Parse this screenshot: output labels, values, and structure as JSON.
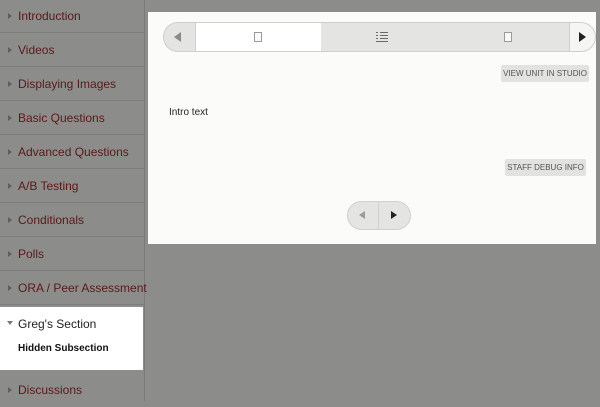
{
  "sidebar": {
    "items": [
      {
        "label": "Introduction"
      },
      {
        "label": "Videos"
      },
      {
        "label": "Displaying Images"
      },
      {
        "label": "Basic Questions"
      },
      {
        "label": "Advanced Questions"
      },
      {
        "label": "A/B Testing"
      },
      {
        "label": "Conditionals"
      },
      {
        "label": "Polls"
      },
      {
        "label": "ORA / Peer Assessment"
      }
    ],
    "active_section": {
      "label": "Greg's Section",
      "subsection": "Hidden Subsection"
    },
    "footer_item": {
      "label": "Discussions"
    }
  },
  "main": {
    "sequence_tabs": [
      {
        "icon": "document-icon",
        "active": true
      },
      {
        "icon": "list-icon",
        "active": false
      },
      {
        "icon": "document-icon",
        "active": false
      }
    ],
    "view_in_studio_label": "VIEW UNIT IN STUDIO",
    "intro_text": "Intro text",
    "staff_debug_label": "STAFF DEBUG INFO"
  },
  "colors": {
    "background": "#8c8c8a",
    "link_text": "#5a1a1a",
    "panel": "#fbfbf9"
  }
}
